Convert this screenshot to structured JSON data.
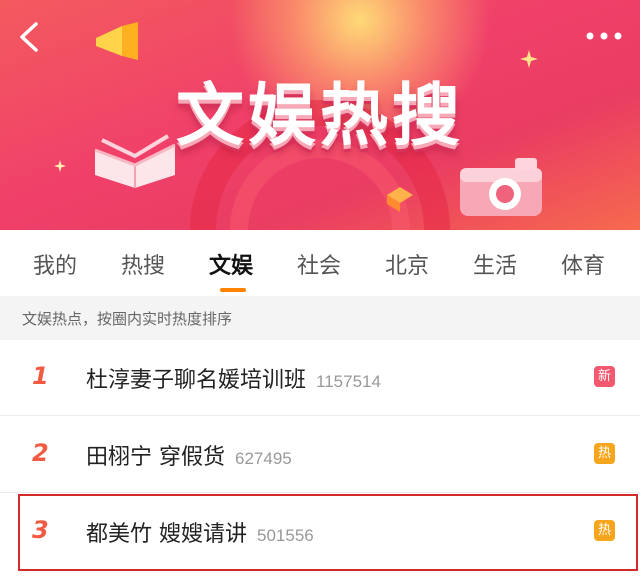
{
  "banner": {
    "title": "文娱热搜",
    "colors": {
      "gradient_start": "#f35a5e",
      "gradient_end": "#f66a4e",
      "title_text": "#ffffff"
    },
    "icons": [
      "back-arrow-icon",
      "more-dots-icon",
      "book-icon",
      "megaphone-icon",
      "camera-icon",
      "sparkle-icon"
    ]
  },
  "tabs": [
    {
      "label": "我的"
    },
    {
      "label": "热搜"
    },
    {
      "label": "文娱"
    },
    {
      "label": "社会"
    },
    {
      "label": "北京"
    },
    {
      "label": "生活"
    },
    {
      "label": "体育"
    }
  ],
  "active_tab": "文娱",
  "accent_color": "#ff8200",
  "subheader": "文娱热点，按圈内实时热度排序",
  "list": [
    {
      "rank": "1",
      "title": "杜淳妻子聊名媛培训班",
      "count": "1157514",
      "badge": "新",
      "badge_color": "#f4586e"
    },
    {
      "rank": "2",
      "title": "田栩宁 穿假货",
      "count": "627495",
      "badge": "热",
      "badge_color": "#f7a51c"
    },
    {
      "rank": "3",
      "title": "都美竹 嫂嫂请讲",
      "count": "501556",
      "badge": "热",
      "badge_color": "#f7a51c"
    }
  ],
  "rank_color": "#f35a42",
  "highlight_color": "#d22a2a"
}
